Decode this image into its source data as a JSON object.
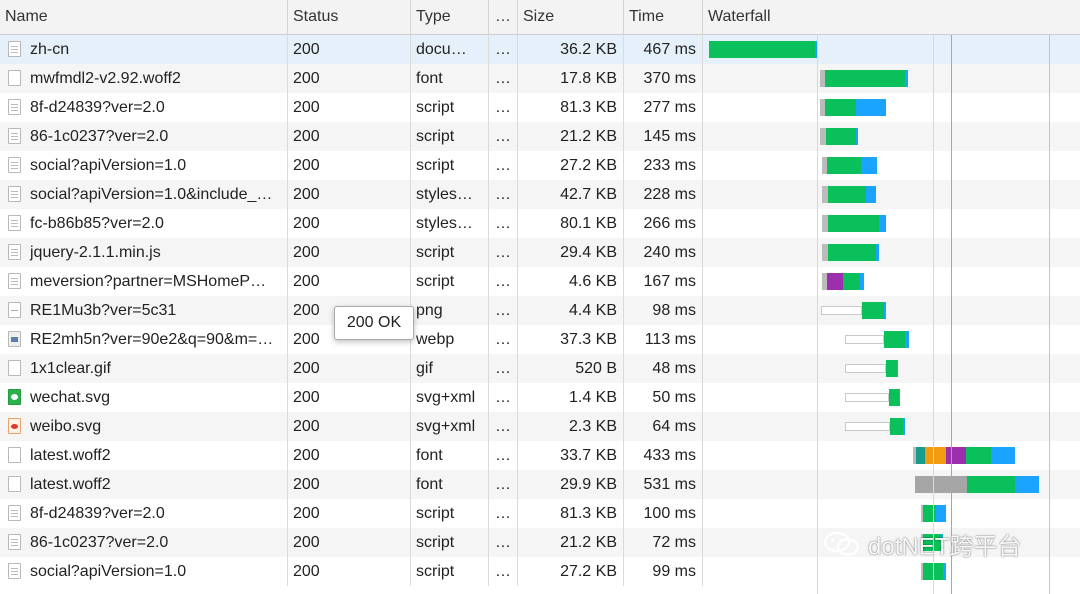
{
  "header": {
    "name": "Name",
    "status": "Status",
    "type": "Type",
    "more": "…",
    "size": "Size",
    "time": "Time",
    "waterfall": "Waterfall"
  },
  "rows": [
    {
      "name": "zh-cn",
      "status": "200",
      "type": "docu…",
      "dots": "…",
      "size": "36.2 KB",
      "time": "467 ms",
      "icon": "document-icon",
      "selected": true,
      "bars": [
        {
          "start": 709,
          "end": 815,
          "color": "#0ac05a"
        },
        {
          "start": 815,
          "end": 818,
          "color": "#1aa3ff"
        }
      ]
    },
    {
      "name": "mwfmdl2-v2.92.woff2",
      "status": "200",
      "type": "font",
      "dots": "…",
      "size": "17.8 KB",
      "time": "370 ms",
      "icon": "file-icon",
      "bars": [
        {
          "start": 820,
          "end": 825,
          "color": "#bbbbbb"
        },
        {
          "start": 825,
          "end": 905,
          "color": "#0ac05a"
        },
        {
          "start": 905,
          "end": 908,
          "color": "#1aa3ff"
        }
      ]
    },
    {
      "name": "8f-d24839?ver=2.0",
      "status": "200",
      "type": "script",
      "dots": "…",
      "size": "81.3 KB",
      "time": "277 ms",
      "icon": "script-icon",
      "bars": [
        {
          "start": 820,
          "end": 825,
          "color": "#bbbbbb"
        },
        {
          "start": 825,
          "end": 856,
          "color": "#0ac05a"
        },
        {
          "start": 856,
          "end": 886,
          "color": "#1aa3ff"
        }
      ]
    },
    {
      "name": "86-1c0237?ver=2.0",
      "status": "200",
      "type": "script",
      "dots": "…",
      "size": "21.2 KB",
      "time": "145 ms",
      "icon": "script-icon",
      "bars": [
        {
          "start": 820,
          "end": 826,
          "color": "#bbbbbb"
        },
        {
          "start": 826,
          "end": 856,
          "color": "#0ac05a"
        },
        {
          "start": 856,
          "end": 858,
          "color": "#1aa3ff"
        }
      ]
    },
    {
      "name": "social?apiVersion=1.0",
      "status": "200",
      "type": "script",
      "dots": "…",
      "size": "27.2 KB",
      "time": "233 ms",
      "icon": "script-icon",
      "bars": [
        {
          "start": 822,
          "end": 827,
          "color": "#bbbbbb"
        },
        {
          "start": 827,
          "end": 861,
          "color": "#0ac05a"
        },
        {
          "start": 861,
          "end": 877,
          "color": "#1aa3ff"
        }
      ]
    },
    {
      "name": "social?apiVersion=1.0&include_…",
      "status": "200",
      "type": "styles…",
      "dots": "…",
      "size": "42.7 KB",
      "time": "228 ms",
      "icon": "stylesheet-icon",
      "bars": [
        {
          "start": 822,
          "end": 828,
          "color": "#bbbbbb"
        },
        {
          "start": 828,
          "end": 866,
          "color": "#0ac05a"
        },
        {
          "start": 866,
          "end": 876,
          "color": "#1aa3ff"
        }
      ]
    },
    {
      "name": "fc-b86b85?ver=2.0",
      "status": "200",
      "type": "styles…",
      "dots": "…",
      "size": "80.1 KB",
      "time": "266 ms",
      "icon": "stylesheet-icon",
      "bars": [
        {
          "start": 822,
          "end": 828,
          "color": "#bbbbbb"
        },
        {
          "start": 828,
          "end": 879,
          "color": "#0ac05a"
        },
        {
          "start": 879,
          "end": 886,
          "color": "#1aa3ff"
        }
      ]
    },
    {
      "name": "jquery-2.1.1.min.js",
      "status": "200",
      "type": "script",
      "dots": "…",
      "size": "29.4 KB",
      "time": "240 ms",
      "icon": "script-icon",
      "bars": [
        {
          "start": 822,
          "end": 828,
          "color": "#bbbbbb"
        },
        {
          "start": 828,
          "end": 876,
          "color": "#0ac05a"
        },
        {
          "start": 876,
          "end": 879,
          "color": "#1aa3ff"
        }
      ]
    },
    {
      "name": "meversion?partner=MSHomeP…",
      "status": "200",
      "type": "script",
      "dots": "…",
      "size": "4.6 KB",
      "time": "167 ms",
      "icon": "script-icon",
      "bars": [
        {
          "start": 822,
          "end": 827,
          "color": "#bbbbbb"
        },
        {
          "start": 827,
          "end": 843,
          "color": "#9b2fae"
        },
        {
          "start": 843,
          "end": 860,
          "color": "#0ac05a"
        },
        {
          "start": 860,
          "end": 864,
          "color": "#1aa3ff"
        }
      ]
    },
    {
      "name": "RE1Mu3b?ver=5c31",
      "status": "200",
      "type": "png",
      "dots": "…",
      "size": "4.4 KB",
      "time": "98 ms",
      "icon": "image-dash-icon",
      "bars": [
        {
          "start": 821,
          "end": 862,
          "color": "#ffffff",
          "outline": true
        },
        {
          "start": 862,
          "end": 884,
          "color": "#0ac05a"
        },
        {
          "start": 884,
          "end": 886,
          "color": "#1aa3ff"
        }
      ]
    },
    {
      "name": "RE2mh5n?ver=90e2&q=90&m=…",
      "status": "200",
      "type": "webp",
      "dots": "…",
      "size": "37.3 KB",
      "time": "113 ms",
      "icon": "image-icon",
      "bars": [
        {
          "start": 845,
          "end": 884,
          "color": "#ffffff",
          "outline": true
        },
        {
          "start": 884,
          "end": 905,
          "color": "#0ac05a"
        },
        {
          "start": 905,
          "end": 909,
          "color": "#1aa3ff"
        }
      ]
    },
    {
      "name": "1x1clear.gif",
      "status": "200",
      "type": "gif",
      "dots": "…",
      "size": "520 B",
      "time": "48 ms",
      "icon": "file-icon",
      "bars": [
        {
          "start": 845,
          "end": 886,
          "color": "#ffffff",
          "outline": true
        },
        {
          "start": 886,
          "end": 897,
          "color": "#0ac05a"
        },
        {
          "start": 897,
          "end": 898,
          "color": "#1aa3ff"
        }
      ]
    },
    {
      "name": "wechat.svg",
      "status": "200",
      "type": "svg+xml",
      "dots": "…",
      "size": "1.4 KB",
      "time": "50 ms",
      "icon": "wechat-icon",
      "bars": [
        {
          "start": 845,
          "end": 889,
          "color": "#ffffff",
          "outline": true
        },
        {
          "start": 889,
          "end": 899,
          "color": "#0ac05a"
        },
        {
          "start": 899,
          "end": 900,
          "color": "#1aa3ff"
        }
      ]
    },
    {
      "name": "weibo.svg",
      "status": "200",
      "type": "svg+xml",
      "dots": "…",
      "size": "2.3 KB",
      "time": "64 ms",
      "icon": "weibo-icon",
      "bars": [
        {
          "start": 845,
          "end": 890,
          "color": "#ffffff",
          "outline": true
        },
        {
          "start": 890,
          "end": 903,
          "color": "#0ac05a"
        },
        {
          "start": 903,
          "end": 905,
          "color": "#1aa3ff"
        }
      ]
    },
    {
      "name": "latest.woff2",
      "status": "200",
      "type": "font",
      "dots": "…",
      "size": "33.7 KB",
      "time": "433 ms",
      "icon": "file-icon",
      "bars": [
        {
          "start": 913,
          "end": 916,
          "color": "#bbbbbb"
        },
        {
          "start": 916,
          "end": 925,
          "color": "#1a9c8c"
        },
        {
          "start": 925,
          "end": 946,
          "color": "#f39c12"
        },
        {
          "start": 946,
          "end": 966,
          "color": "#9b2fae"
        },
        {
          "start": 966,
          "end": 991,
          "color": "#0ac05a"
        },
        {
          "start": 991,
          "end": 1015,
          "color": "#1aa3ff"
        }
      ]
    },
    {
      "name": "latest.woff2",
      "status": "200",
      "type": "font",
      "dots": "…",
      "size": "29.9 KB",
      "time": "531 ms",
      "icon": "file-icon",
      "bars": [
        {
          "start": 915,
          "end": 967,
          "color": "#a5a5a5"
        },
        {
          "start": 967,
          "end": 1015,
          "color": "#0ac05a"
        },
        {
          "start": 1015,
          "end": 1039,
          "color": "#1aa3ff"
        }
      ]
    },
    {
      "name": "8f-d24839?ver=2.0",
      "status": "200",
      "type": "script",
      "dots": "…",
      "size": "81.3 KB",
      "time": "100 ms",
      "icon": "script-icon",
      "bars": [
        {
          "start": 921,
          "end": 923,
          "color": "#bbbbbb"
        },
        {
          "start": 923,
          "end": 936,
          "color": "#0ac05a"
        },
        {
          "start": 936,
          "end": 946,
          "color": "#1aa3ff"
        }
      ]
    },
    {
      "name": "86-1c0237?ver=2.0",
      "status": "200",
      "type": "script",
      "dots": "…",
      "size": "21.2 KB",
      "time": "72 ms",
      "icon": "script-icon",
      "bars": [
        {
          "start": 921,
          "end": 923,
          "color": "#bbbbbb"
        },
        {
          "start": 923,
          "end": 941,
          "color": "#0ac05a"
        },
        {
          "start": 941,
          "end": 943,
          "color": "#1aa3ff"
        }
      ]
    },
    {
      "name": "social?apiVersion=1.0",
      "status": "200",
      "type": "script",
      "dots": "…",
      "size": "27.2 KB",
      "time": "99 ms",
      "icon": "script-icon",
      "bars": [
        {
          "start": 921,
          "end": 923,
          "color": "#bbbbbb"
        },
        {
          "start": 923,
          "end": 943,
          "color": "#0ac05a"
        },
        {
          "start": 943,
          "end": 946,
          "color": "#1aa3ff"
        }
      ]
    }
  ],
  "tooltip": {
    "text": "200 OK"
  },
  "watermark": {
    "text": "dotNET跨平台"
  },
  "colors": {
    "selected_row": "#e6f0fb",
    "dom_content_loaded": "#4a6fe0",
    "load_event": "#e04a4a"
  }
}
